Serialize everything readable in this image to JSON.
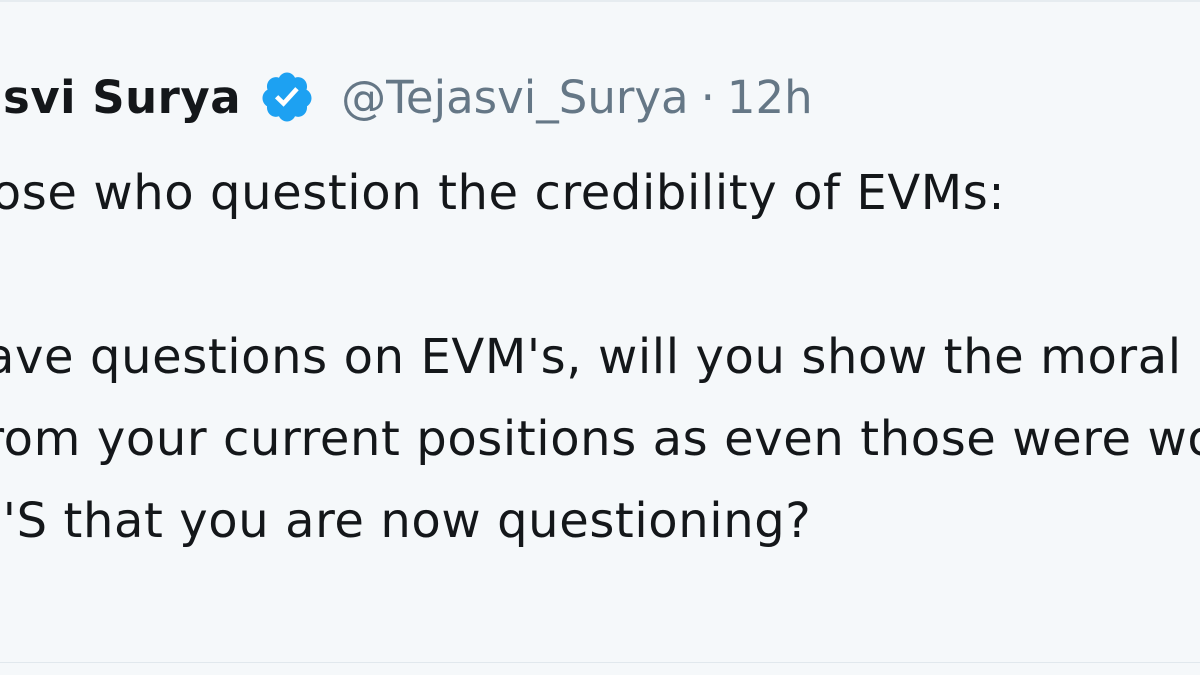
{
  "tweet": {
    "display_name": "Tejasvi Surya",
    "handle": "@Tejasvi_Surya",
    "separator": "·",
    "time": "12h",
    "lines": [
      "To all those who question the credibility of EVMs:",
      "",
      "If you have questions on EVM's, will you show the moral courage to",
      "resign from your current positions as even those were won using",
      "the EVM'S that you are now questioning?"
    ]
  },
  "colors": {
    "text": "#14171a",
    "secondary": "#657786",
    "verified_badge": "#1da1f2",
    "background": "#f5f8fa"
  },
  "icons": {
    "verified": "verified-badge-icon"
  }
}
